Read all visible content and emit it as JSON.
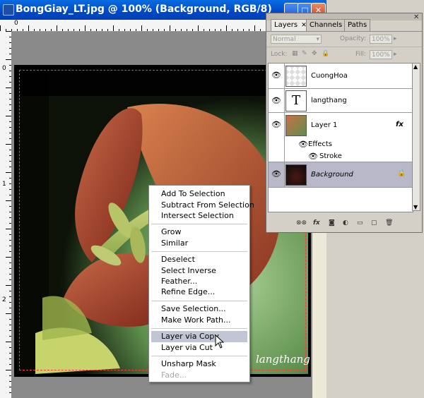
{
  "document": {
    "title": "BongGiay_LT.jpg @ 100% (Background, RGB/8)",
    "window_buttons": [
      "minimize-icon",
      "maximize-icon",
      "close-icon"
    ],
    "ruler_top_labels": [
      "0"
    ],
    "ruler_left_labels": [
      "0",
      "1",
      "2"
    ],
    "signature": "langthang"
  },
  "context_menu": {
    "items": [
      {
        "label": "Add To Selection",
        "enabled": true,
        "highlighted": false
      },
      {
        "label": "Subtract From Selection",
        "enabled": true,
        "highlighted": false
      },
      {
        "label": "Intersect Selection",
        "enabled": true,
        "highlighted": false
      },
      {
        "label": "Grow",
        "enabled": true,
        "highlighted": false
      },
      {
        "label": "Similar",
        "enabled": true,
        "highlighted": false
      },
      {
        "label": "Deselect",
        "enabled": true,
        "highlighted": false
      },
      {
        "label": "Select Inverse",
        "enabled": true,
        "highlighted": false
      },
      {
        "label": "Feather...",
        "enabled": true,
        "highlighted": false
      },
      {
        "label": "Refine Edge...",
        "enabled": true,
        "highlighted": false
      },
      {
        "label": "Save Selection...",
        "enabled": true,
        "highlighted": false
      },
      {
        "label": "Make Work Path...",
        "enabled": true,
        "highlighted": false
      },
      {
        "label": "Layer via Copy",
        "enabled": true,
        "highlighted": true
      },
      {
        "label": "Layer via Cut",
        "enabled": true,
        "highlighted": false
      },
      {
        "label": "Unsharp Mask",
        "enabled": true,
        "highlighted": false
      },
      {
        "label": "Fade...",
        "enabled": false,
        "highlighted": false
      }
    ]
  },
  "layers_panel": {
    "tabs": [
      "Layers",
      "Channels",
      "Paths"
    ],
    "active_tab": "Layers",
    "blend_mode": "Normal",
    "opacity_label": "Opacity:",
    "opacity_value": "100%",
    "lock_label": "Lock:",
    "fill_label": "Fill:",
    "fill_value": "100%",
    "layers": [
      {
        "name": "CuongHoa",
        "thumb": "transparent",
        "selected": false
      },
      {
        "name": "langthang",
        "thumb": "text",
        "selected": false
      },
      {
        "name": "Layer 1",
        "thumb": "image",
        "selected": false,
        "fx": "fx"
      },
      {
        "name": "Background",
        "thumb": "dark-image",
        "selected": true
      }
    ],
    "effects_label": "Effects",
    "stroke_label": "Stroke",
    "text_thumb_glyph": "T",
    "footer_icons": [
      "link-layers-icon",
      "fx-icon",
      "mask-icon",
      "adjustment-icon",
      "group-icon",
      "new-layer-icon",
      "trash-icon"
    ]
  },
  "colors": {
    "title_bar": "#0054e3",
    "menu_highlight": "#c0c6d4",
    "selected_layer": "#b8b8c8",
    "marquee": "#ff3a3a"
  }
}
